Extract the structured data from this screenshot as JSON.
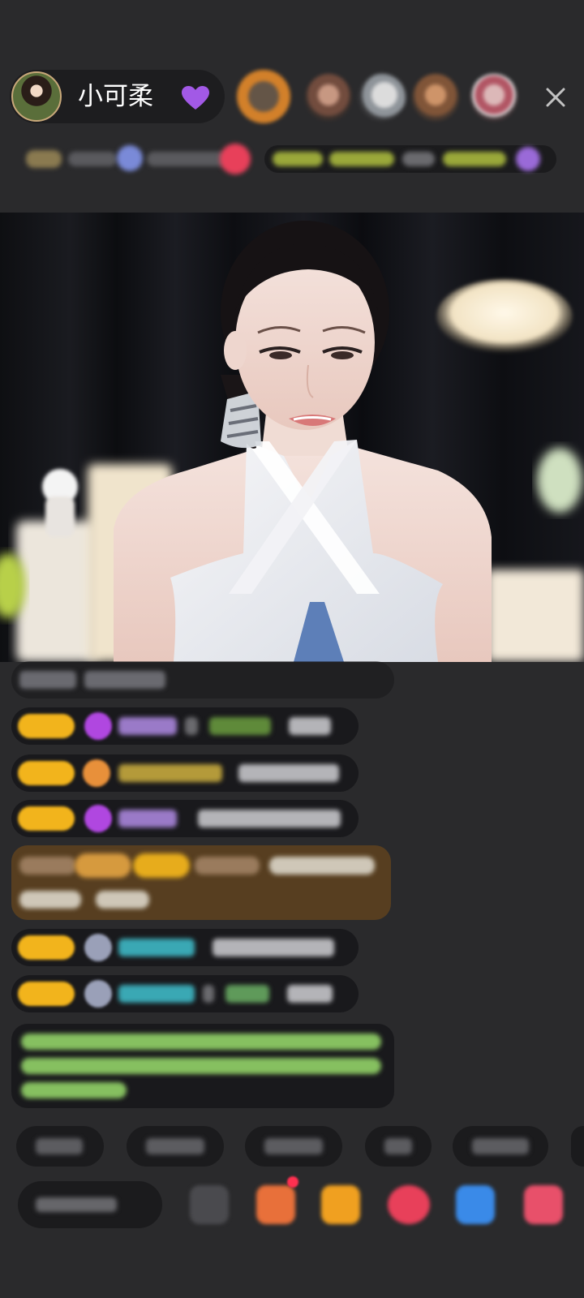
{
  "header": {
    "host_name": "小可柔",
    "host_heart_icon": "purple-heart-icon",
    "close_icon": "close-icon"
  },
  "colors": {
    "background": "#2a2a2c",
    "pill": "#1d1d1f",
    "heart": "#a259e6",
    "badge_gold": "#f2b41c",
    "chat_highlight": "#6a4a1e",
    "green_text": "#8fcf5a"
  }
}
